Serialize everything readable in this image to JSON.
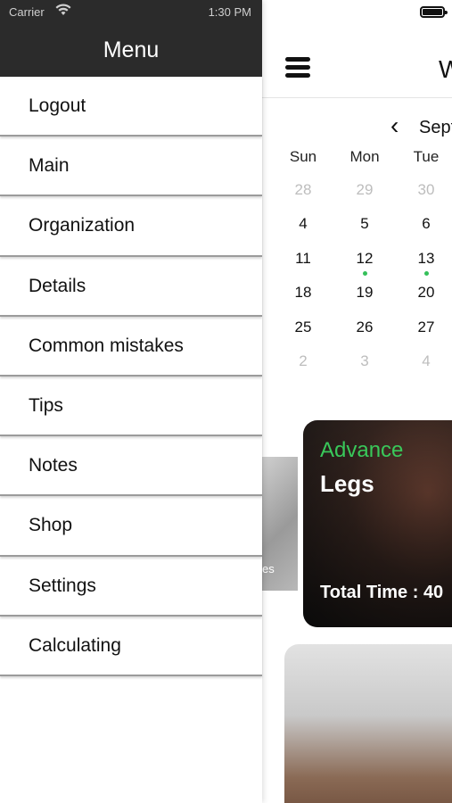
{
  "status_bar": {
    "carrier": "Carrier",
    "time": "1:30 PM"
  },
  "menu": {
    "title": "Menu",
    "items": [
      {
        "label": "Logout"
      },
      {
        "label": "Main"
      },
      {
        "label": "Organization"
      },
      {
        "label": "Details"
      },
      {
        "label": "Common mistakes"
      },
      {
        "label": "Tips"
      },
      {
        "label": "Notes"
      },
      {
        "label": "Shop"
      },
      {
        "label": "Settings"
      },
      {
        "label": "Calculating"
      }
    ]
  },
  "main": {
    "title_partial": "W",
    "calendar": {
      "month_partial": "Sept",
      "weekdays": [
        "Sun",
        "Mon",
        "Tue"
      ],
      "rows": [
        [
          "28",
          "29",
          "30"
        ],
        [
          "4",
          "5",
          "6"
        ],
        [
          "11",
          "12",
          "13"
        ],
        [
          "18",
          "19",
          "20"
        ],
        [
          "25",
          "26",
          "27"
        ],
        [
          "2",
          "3",
          "4"
        ]
      ],
      "event_dot_color": "#35c05a"
    },
    "partial_card_text": "es",
    "workout_card": {
      "level": "Advance",
      "name": "Legs",
      "total_time": "Total Time : 40"
    }
  },
  "colors": {
    "header_bg": "#2b2b2b",
    "accent_green": "#39c85a"
  }
}
